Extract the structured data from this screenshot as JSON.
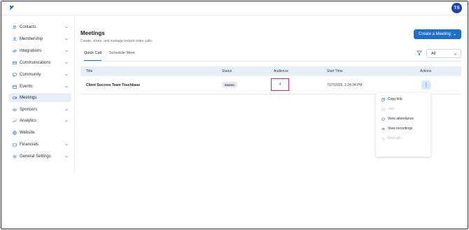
{
  "topbar": {
    "avatar_initials": "TS"
  },
  "sidebar": {
    "items": [
      {
        "label": "Contacts",
        "icon": "users-icon",
        "chevron": true
      },
      {
        "label": "Membership",
        "icon": "person-icon",
        "chevron": true
      },
      {
        "label": "Integrations",
        "icon": "link-icon",
        "chevron": true
      },
      {
        "label": "Communications",
        "icon": "mail-icon",
        "chevron": true
      },
      {
        "label": "Community",
        "icon": "chat-icon",
        "chevron": true
      },
      {
        "label": "Events",
        "icon": "calendar-icon",
        "chevron": true
      },
      {
        "label": "Meetings",
        "icon": "video-icon",
        "chevron": false,
        "active": true
      },
      {
        "label": "Sponsors",
        "icon": "handshake-icon",
        "chevron": true
      },
      {
        "label": "Analytics",
        "icon": "chart-icon",
        "chevron": true
      },
      {
        "label": "Website",
        "icon": "globe-icon",
        "chevron": false
      },
      {
        "label": "Financials",
        "icon": "wallet-icon",
        "chevron": true
      },
      {
        "label": "General Settings",
        "icon": "gear-icon",
        "chevron": true
      }
    ]
  },
  "header": {
    "title": "Meetings",
    "subtitle": "Create, share, and manage instant video calls.",
    "create_button": "Create a Meeting"
  },
  "tabs": [
    {
      "label": "Quick Call",
      "active": true
    },
    {
      "label": "Schedule Meet",
      "active": false
    }
  ],
  "filter": {
    "selected": "All"
  },
  "table": {
    "columns": [
      "Title",
      "Status",
      "Audience",
      "Start Time",
      "Actions"
    ],
    "rows": [
      {
        "title": "Client Success Team Touchbase",
        "status": "ENDED",
        "audience": "4",
        "start_time": "7/27/2026, 1:24:24 PM"
      }
    ]
  },
  "actions_menu": {
    "items": [
      {
        "label": "Copy link",
        "icon": "copy-icon",
        "enabled": true
      },
      {
        "label": "Join",
        "icon": "join-icon",
        "enabled": false
      },
      {
        "label": "View attendance",
        "icon": "check-circle-icon",
        "enabled": true
      },
      {
        "label": "View recordings",
        "icon": "eye-icon",
        "enabled": true
      },
      {
        "label": "End call",
        "icon": "phone-off-icon",
        "enabled": false
      }
    ]
  },
  "colors": {
    "primary": "#1d6fc9",
    "avatar": "#1d3fb8",
    "active_nav": "#e6eef8",
    "highlight_box": "#d6246e"
  }
}
